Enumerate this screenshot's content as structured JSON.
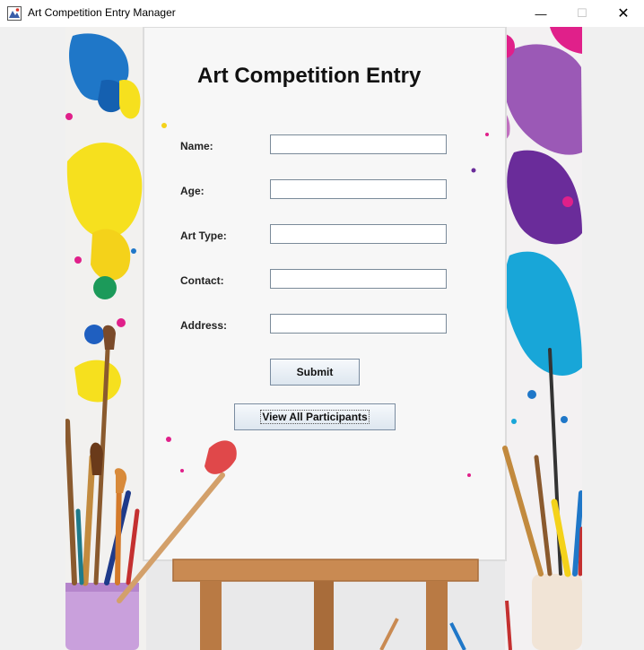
{
  "window": {
    "title": "Art Competition Entry Manager",
    "minimize": "—",
    "maximize": "☐",
    "close": "✕"
  },
  "form": {
    "heading": "Art Competition Entry",
    "fields": [
      {
        "label": "Name:",
        "value": ""
      },
      {
        "label": "Age:",
        "value": ""
      },
      {
        "label": "Art Type:",
        "value": ""
      },
      {
        "label": "Contact:",
        "value": ""
      },
      {
        "label": "Address:",
        "value": ""
      }
    ],
    "submit_label": "Submit",
    "view_all_label": "View All Participants"
  },
  "colors": {
    "paint_blue": "#1f77c8",
    "paint_yellow": "#f6e01e",
    "paint_magenta": "#e0208a",
    "paint_purple": "#6a2c9a",
    "paint_cyan": "#18a6d8",
    "easel_wood": "#c98a52"
  }
}
